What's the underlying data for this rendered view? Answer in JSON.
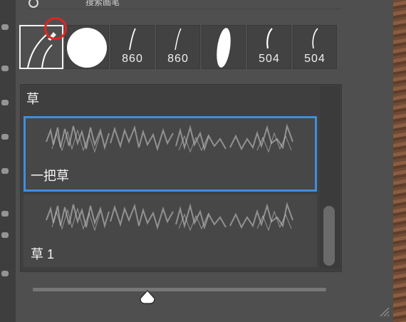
{
  "panel": {
    "search_placeholder": "搜索画笔"
  },
  "presets": [
    {
      "kind": "pencil",
      "size_label": "",
      "selected": true
    },
    {
      "kind": "round",
      "size_label": "",
      "selected": false
    },
    {
      "kind": "stroke",
      "size_label": "860",
      "selected": false
    },
    {
      "kind": "stroke",
      "size_label": "860",
      "selected": false
    },
    {
      "kind": "oval",
      "size_label": "",
      "selected": false
    },
    {
      "kind": "stroke",
      "size_label": "504",
      "selected": false
    },
    {
      "kind": "stroke",
      "size_label": "504",
      "selected": false
    }
  ],
  "brush_list": {
    "group_label": "草",
    "items": [
      {
        "name": "一把草",
        "selected": true
      },
      {
        "name": "草 1",
        "selected": false
      }
    ]
  },
  "size_slider": {
    "value_fraction": 0.39
  },
  "colors": {
    "selection_accent": "#3d8fe0",
    "annotation": "#e0261f"
  }
}
